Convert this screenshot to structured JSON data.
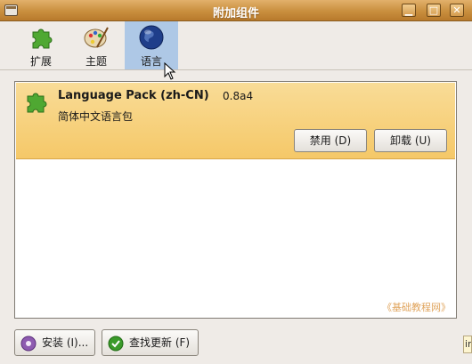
{
  "window": {
    "title": "附加组件",
    "controls": {
      "minimize": "▁",
      "maximize": "□",
      "close": "✕"
    }
  },
  "tabs": [
    {
      "label": "扩展",
      "icon": "puzzle-icon",
      "active": false
    },
    {
      "label": "主题",
      "icon": "palette-icon",
      "active": false
    },
    {
      "label": "语言",
      "icon": "globe-icon",
      "active": true
    }
  ],
  "addon": {
    "name": "Language Pack (zh-CN)",
    "version": "0.8a4",
    "description": "简体中文语言包",
    "disable_label": "禁用 (D)",
    "uninstall_label": "卸载 (U)"
  },
  "watermark": "《基础教程网》",
  "footer": {
    "install_label": "安装 (I)...",
    "update_label": "查找更新 (F)"
  },
  "corner_text": "ir",
  "colors": {
    "titlebar": "#c98f3e",
    "selected_item": "#f5c868",
    "active_tab": "#aec8e6"
  }
}
